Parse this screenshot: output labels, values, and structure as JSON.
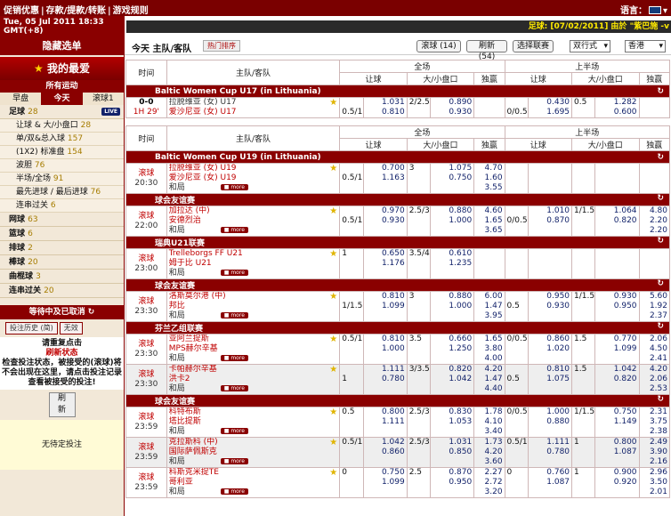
{
  "top": {
    "nav": [
      "促销优惠",
      "|",
      "存款/提款/转账",
      "|",
      "游戏规则"
    ],
    "lang_label": "语言："
  },
  "date": {
    "line1": "Tue, 05 Jul 2011 18:33",
    "line2": "GMT(+8)"
  },
  "ticker": "足球: [07/02/2011] 由於 \"紫巴施 -v",
  "sidebar": {
    "hide_menu": "隐藏选单",
    "favorites": "我的最爱",
    "all_sports": "所有运动",
    "tabs": [
      "早盘",
      "今天",
      "滚球1"
    ],
    "football": {
      "name": "足球",
      "count": "28",
      "live": "LIVE"
    },
    "subs": [
      {
        "n": "让球 & 大/小盘口",
        "c": "28"
      },
      {
        "n": "单/双&总入球",
        "c": "157"
      },
      {
        "n": "(1X2) 标准盘",
        "c": "154"
      },
      {
        "n": "波胆",
        "c": "76"
      },
      {
        "n": "半场/全场",
        "c": "91"
      },
      {
        "n": "最先进球 / 最后进球",
        "c": "76"
      },
      {
        "n": "连串过关",
        "c": "6"
      }
    ],
    "sports": [
      {
        "n": "网球",
        "c": "63"
      },
      {
        "n": "篮球",
        "c": "6"
      },
      {
        "n": "排球",
        "c": "2"
      },
      {
        "n": "棒球",
        "c": "20"
      },
      {
        "n": "曲棍球",
        "c": "3"
      },
      {
        "n": "连串过关",
        "c": "20"
      }
    ],
    "pending_title": "等待中及已取消",
    "hist_btn": "投注历史 (简)",
    "cancel_btn": "无效",
    "msg_a": "请重复点击",
    "msg_b": "刷新状态",
    "msg_c": "检查投注状态，被接受的(滚球)将不会出现在这里，请点击投注记录查看被接受的投注!",
    "refresh": "刷新",
    "no_bets": "无待定投注"
  },
  "toolbar": {
    "title": "今天 主队/客队",
    "hot": "热门排序",
    "live_btn": "滚球 (14)",
    "refresh_btn": "刷新(54)",
    "select_btn": "选择联赛",
    "odds_sel": "双行式",
    "region_sel": "香港"
  },
  "headers": {
    "time": "时间",
    "teams": "主队/客队",
    "full": "全场",
    "half": "上半场",
    "hdp": "让球",
    "ou": "大/小盘口",
    "oe": "独赢"
  },
  "live_table": {
    "league": "Baltic Women Cup U17 (in Lithuania)",
    "match": {
      "score": "0-0",
      "time": "1H 29'",
      "home": "拉脱维亚 (女) U17",
      "away": "爱沙尼亚 (女) U17",
      "hdp": [
        "",
        "0.5/1",
        "1.031",
        "0.810"
      ],
      "ou": [
        "2/2.5",
        "",
        "0.890",
        "0.930"
      ],
      "oe": [
        "",
        "",
        ""
      ],
      "h_hdp": [
        "",
        "0/0.5",
        "0.430",
        "1.695"
      ],
      "h_ou": [
        "0.5",
        "",
        "1.282",
        "0.600"
      ],
      "h_oe": [
        "",
        "",
        ""
      ]
    }
  },
  "groups": [
    {
      "league": "Baltic Women Cup U19 (in Lithuania)",
      "matches": [
        {
          "t1": "滚球",
          "t2": "20:30",
          "home": "拉脱维亚 (女) U19",
          "away": "爱沙尼亚 (女) U19",
          "draw": "和局",
          "hl": [
            "",
            "0.5/1"
          ],
          "ho": [
            "0.700",
            "1.163"
          ],
          "ol": [
            "3",
            ""
          ],
          "oo": [
            "1.075",
            "0.750"
          ],
          "oe": [
            "4.70",
            "1.60",
            "3.55"
          ],
          "hhl": [
            "",
            ""
          ],
          "hho": [
            "",
            ""
          ],
          "hol": [
            "",
            ""
          ],
          "hoo": [
            "",
            ""
          ],
          "hoe": [
            "",
            "",
            ""
          ]
        }
      ]
    },
    {
      "league": "球会友谊赛",
      "matches": [
        {
          "t1": "滚球",
          "t2": "22:00",
          "home": "加拉达 (中)",
          "away": "安德烈治",
          "draw": "和局",
          "hl": [
            "",
            "0.5/1"
          ],
          "ho": [
            "0.970",
            "0.930"
          ],
          "ol": [
            "2.5/3",
            ""
          ],
          "oo": [
            "0.880",
            "1.000"
          ],
          "oe": [
            "4.60",
            "1.65",
            "3.65"
          ],
          "hhl": [
            "",
            "0/0.5"
          ],
          "hho": [
            "1.010",
            "0.870"
          ],
          "hol": [
            "1/1.5",
            ""
          ],
          "hoo": [
            "1.064",
            "0.820"
          ],
          "hoe": [
            "4.80",
            "2.20",
            "2.20"
          ]
        }
      ]
    },
    {
      "league": "瑞典U21联赛",
      "matches": [
        {
          "t1": "滚球",
          "t2": "23:00",
          "home": "Trelleborgs FF U21",
          "away": "姆于比 U21",
          "draw": "和局",
          "hl": [
            "1",
            ""
          ],
          "ho": [
            "0.650",
            "1.176"
          ],
          "ol": [
            "3.5/4",
            ""
          ],
          "oo": [
            "0.610",
            "1.235"
          ],
          "oe": [
            "",
            "",
            ""
          ],
          "hhl": [
            "",
            ""
          ],
          "hho": [
            "",
            ""
          ],
          "hol": [
            "",
            ""
          ],
          "hoo": [
            "",
            ""
          ],
          "hoe": [
            "",
            "",
            ""
          ]
        }
      ]
    },
    {
      "league": "球会友谊赛",
      "matches": [
        {
          "t1": "滚球",
          "t2": "23:30",
          "home": "洛斯莫尔港 (中)",
          "away": "邦比",
          "draw": "和局",
          "hl": [
            "",
            "1/1.5"
          ],
          "ho": [
            "0.810",
            "1.099"
          ],
          "ol": [
            "3",
            ""
          ],
          "oo": [
            "0.880",
            "1.000"
          ],
          "oe": [
            "6.00",
            "1.47",
            "3.95"
          ],
          "hhl": [
            "",
            "0.5"
          ],
          "hho": [
            "0.950",
            "0.930"
          ],
          "hol": [
            "1/1.5",
            ""
          ],
          "hoo": [
            "0.930",
            "0.950"
          ],
          "hoe": [
            "5.60",
            "1.92",
            "2.37"
          ]
        }
      ]
    },
    {
      "league": "芬兰乙组联赛",
      "matches": [
        {
          "t1": "滚球",
          "t2": "23:30",
          "home": "亚阿兰提斯",
          "away": "MPS赫尔辛基",
          "draw": "和局",
          "hl": [
            "0.5/1",
            ""
          ],
          "ho": [
            "0.810",
            "1.000"
          ],
          "ol": [
            "3.5",
            ""
          ],
          "oo": [
            "0.660",
            "1.250"
          ],
          "oe": [
            "1.65",
            "3.80",
            "4.00"
          ],
          "hhl": [
            "0/0.5",
            ""
          ],
          "hho": [
            "0.860",
            "1.020"
          ],
          "hol": [
            "1.5",
            ""
          ],
          "hoo": [
            "0.770",
            "1.099"
          ],
          "hoe": [
            "2.06",
            "4.50",
            "2.41"
          ]
        },
        {
          "t1": "滚球",
          "t2": "23:30",
          "home": "卡帕赫尔辛基",
          "away": "洪卡2",
          "draw": "和局",
          "hl": [
            "",
            "1"
          ],
          "ho": [
            "1.111",
            "0.780"
          ],
          "ol": [
            "3/3.5",
            ""
          ],
          "oo": [
            "0.820",
            "1.042"
          ],
          "oe": [
            "4.20",
            "1.47",
            "4.40"
          ],
          "hhl": [
            "",
            "0.5"
          ],
          "hho": [
            "0.810",
            "1.075"
          ],
          "hol": [
            "1.5",
            ""
          ],
          "hoo": [
            "1.042",
            "0.820"
          ],
          "hoe": [
            "4.20",
            "2.06",
            "2.53"
          ]
        }
      ]
    },
    {
      "league": "球会友谊赛",
      "matches": [
        {
          "t1": "滚球",
          "t2": "23:59",
          "home": "科特布斯",
          "away": "塔比提斯",
          "draw": "和局",
          "hl": [
            "0.5",
            ""
          ],
          "ho": [
            "0.800",
            "1.111"
          ],
          "ol": [
            "2.5/3",
            ""
          ],
          "oo": [
            "0.830",
            "1.053"
          ],
          "oe": [
            "1.78",
            "4.10",
            "3.40"
          ],
          "hhl": [
            "0/0.5",
            ""
          ],
          "hho": [
            "1.000",
            "0.880"
          ],
          "hol": [
            "1/1.5",
            ""
          ],
          "hoo": [
            "0.750",
            "1.149"
          ],
          "hoe": [
            "2.31",
            "3.75",
            "2.38"
          ]
        },
        {
          "t1": "滚球",
          "t2": "23:59",
          "home": "克拉斯科 (中)",
          "away": "国际萨佩斯克",
          "draw": "和局",
          "hl": [
            "0.5/1",
            ""
          ],
          "ho": [
            "1.042",
            "0.860"
          ],
          "ol": [
            "2.5/3",
            ""
          ],
          "oo": [
            "1.031",
            "0.850"
          ],
          "oe": [
            "1.73",
            "4.20",
            "3.60"
          ],
          "hhl": [
            "0.5/1",
            ""
          ],
          "hho": [
            "1.111",
            "0.780"
          ],
          "hol": [
            "1",
            ""
          ],
          "hoo": [
            "0.800",
            "1.087"
          ],
          "hoe": [
            "2.49",
            "3.90",
            "2.16"
          ]
        },
        {
          "t1": "滚球",
          "t2": "23:59",
          "home": "科斯克米提TE",
          "away": "哥利亚",
          "draw": "和局",
          "hl": [
            "0",
            ""
          ],
          "ho": [
            "0.750",
            "1.099"
          ],
          "ol": [
            "2.5",
            ""
          ],
          "oo": [
            "0.870",
            "0.950"
          ],
          "oe": [
            "2.27",
            "2.72",
            "3.20"
          ],
          "hhl": [
            "0",
            ""
          ],
          "hho": [
            "0.760",
            "1.087"
          ],
          "hol": [
            "1",
            ""
          ],
          "hoo": [
            "0.900",
            "0.920"
          ],
          "hoe": [
            "2.96",
            "3.50",
            "2.01"
          ]
        }
      ]
    }
  ],
  "more_label": "more",
  "colors": {
    "primary": "#8a0000",
    "odds": "#12226a",
    "team_home": "#c00000"
  }
}
